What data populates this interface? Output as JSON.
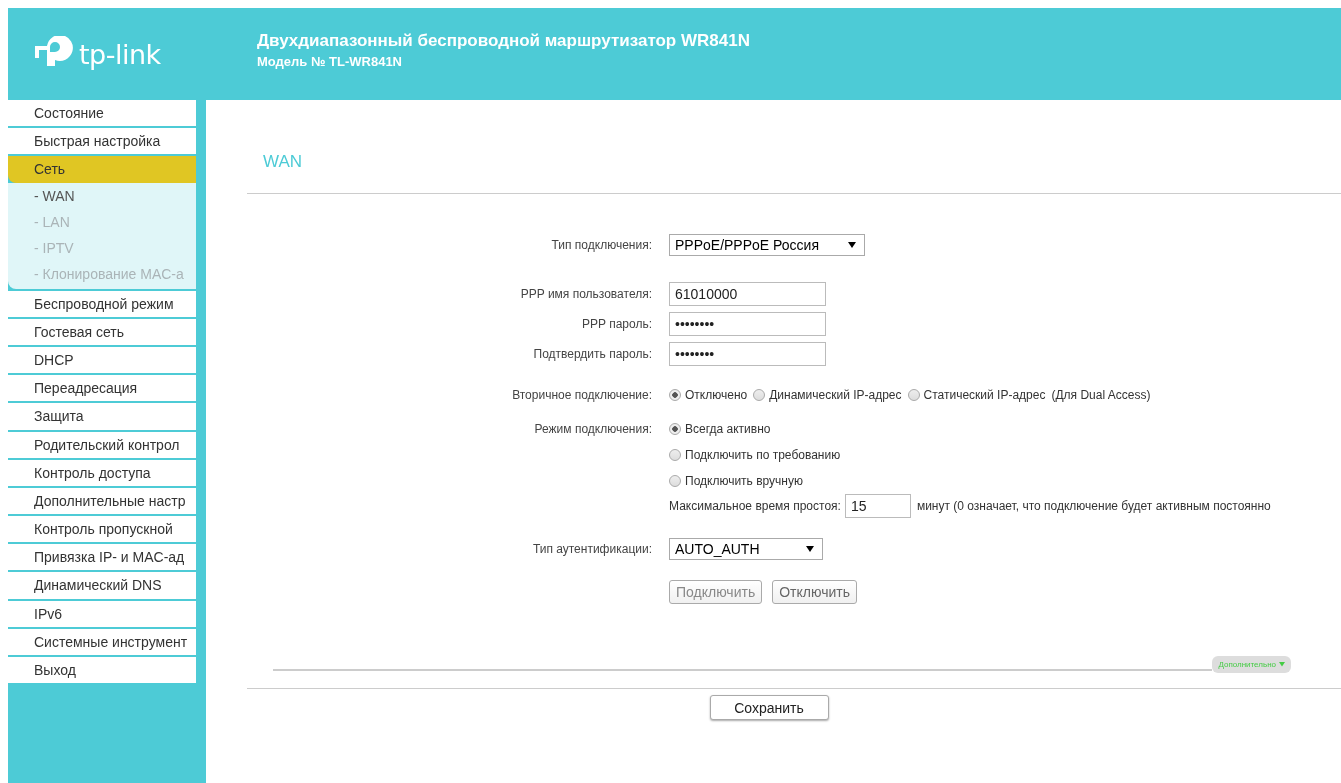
{
  "header": {
    "logo": "tp-link",
    "title": "Двухдиапазонный беспроводной маршрутизатор WR841N",
    "model": "Модель № TL-WR841N"
  },
  "sidebar": {
    "items": [
      {
        "label": "Состояние",
        "selected": false
      },
      {
        "label": "Быстрая настройка",
        "selected": false
      },
      {
        "label": "Сеть",
        "selected": true,
        "children": [
          {
            "label": "- WAN",
            "selected": true
          },
          {
            "label": "- LAN",
            "selected": false
          },
          {
            "label": "- IPTV",
            "selected": false
          },
          {
            "label": "- Клонирование MAC-а",
            "selected": false
          }
        ]
      },
      {
        "label": "Беспроводной режим",
        "selected": false
      },
      {
        "label": "Гостевая сеть",
        "selected": false
      },
      {
        "label": "DHCP",
        "selected": false
      },
      {
        "label": "Переадресация",
        "selected": false
      },
      {
        "label": "Защита",
        "selected": false
      },
      {
        "label": "Родительский контрол",
        "selected": false
      },
      {
        "label": "Контроль доступа",
        "selected": false
      },
      {
        "label": "Дополнительные настр",
        "selected": false
      },
      {
        "label": "Контроль пропускной",
        "selected": false
      },
      {
        "label": "Привязка IP- и MAC-ад",
        "selected": false
      },
      {
        "label": "Динамический DNS",
        "selected": false
      },
      {
        "label": "IPv6",
        "selected": false
      },
      {
        "label": "Системные инструмент",
        "selected": false
      },
      {
        "label": "Выход",
        "selected": false
      }
    ]
  },
  "page": {
    "title": "WAN"
  },
  "form": {
    "connection_type": {
      "label": "Тип подключения:",
      "value": "PPPoE/PPPoE Россия"
    },
    "username": {
      "label": "PPP имя пользователя:",
      "value": "61010000"
    },
    "password": {
      "label": "PPP пароль:",
      "value": "••••••••"
    },
    "confirm": {
      "label": "Подтвердить пароль:",
      "value": "••••••••"
    },
    "secondary": {
      "label": "Вторичное подключение:",
      "options": [
        {
          "label": "Отключено",
          "selected": true
        },
        {
          "label": "Динамический IP-адрес",
          "selected": false
        },
        {
          "label": "Статический IP-адрес",
          "selected": false
        }
      ],
      "note": "(Для Dual Access)"
    },
    "mode": {
      "label": "Режим подключения:",
      "options": [
        {
          "label": "Всегда активно",
          "selected": true
        },
        {
          "label": "Подключить по требованию",
          "selected": false
        },
        {
          "label": "Подключить вручную",
          "selected": false
        }
      ]
    },
    "idle": {
      "label": "Максимальное время простоя:",
      "value": "15",
      "note": "минут (0 означает, что подключение будет активным постоянно"
    },
    "auth": {
      "label": "Тип аутентификации:",
      "value": "AUTO_AUTH"
    },
    "buttons": [
      {
        "label": "Подключить",
        "disabled": true
      },
      {
        "label": "Отключить",
        "disabled": false
      }
    ]
  },
  "advanced": {
    "label": "Дополнительно"
  },
  "save": {
    "label": "Сохранить"
  }
}
